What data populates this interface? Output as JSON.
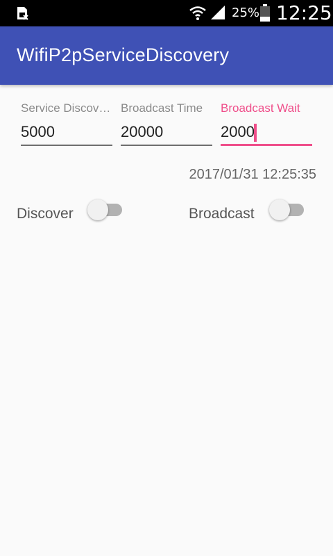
{
  "status_bar": {
    "battery": "25%",
    "time": "12:25",
    "icons": [
      "sim-card-icon",
      "wifi-icon",
      "cell-signal-icon",
      "battery-icon"
    ]
  },
  "app_bar": {
    "title": "WifiP2pServiceDiscovery",
    "color": "#3f51b5"
  },
  "fields": [
    {
      "label": "Service Discov…",
      "value": "5000"
    },
    {
      "label": "Broadcast Time",
      "value": "20000"
    },
    {
      "label": "Broadcast Wait",
      "value": "2000",
      "focused": true
    }
  ],
  "datetime": "2017/01/31 12:25:35",
  "switches": [
    {
      "label": "Discover",
      "checked": false
    },
    {
      "label": "Broadcast",
      "checked": false
    }
  ],
  "colors": {
    "accent": "#ef4e8a",
    "primary": "#3f51b5"
  }
}
